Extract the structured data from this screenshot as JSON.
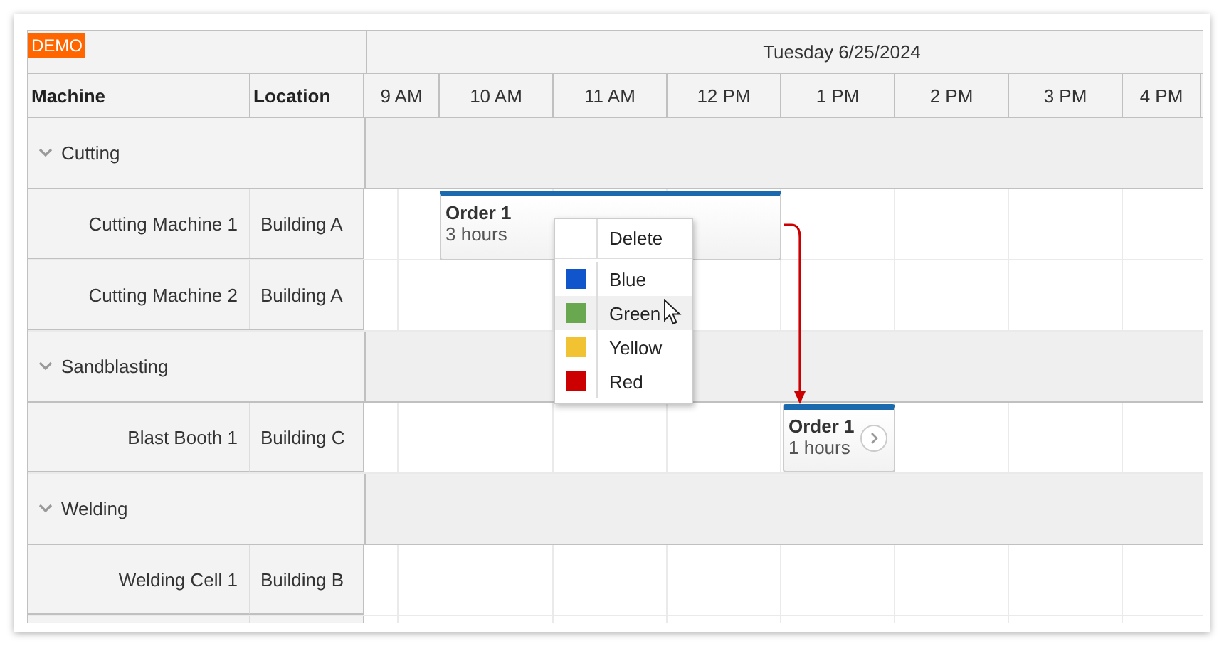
{
  "demo_badge": "DEMO",
  "date_header": "Tuesday 6/25/2024",
  "columns": [
    "Machine",
    "Location"
  ],
  "hours": [
    "9 AM",
    "10 AM",
    "11 AM",
    "12 PM",
    "1 PM",
    "2 PM",
    "3 PM",
    "4 PM"
  ],
  "rows": [
    {
      "kind": "group",
      "name": "Cutting",
      "expanded": true
    },
    {
      "kind": "resource",
      "name": "Cutting Machine 1",
      "location": "Building A",
      "events": [
        {
          "title": "Order 1",
          "duration": "3 hours"
        }
      ]
    },
    {
      "kind": "resource",
      "name": "Cutting Machine 2",
      "location": "Building A"
    },
    {
      "kind": "group",
      "name": "Sandblasting",
      "expanded": true
    },
    {
      "kind": "resource",
      "name": "Blast Booth 1",
      "location": "Building C",
      "events": [
        {
          "title": "Order 1",
          "duration": "1 hours"
        }
      ]
    },
    {
      "kind": "group",
      "name": "Welding",
      "expanded": true
    },
    {
      "kind": "resource",
      "name": "Welding Cell 1",
      "location": "Building B"
    }
  ],
  "context_menu": [
    {
      "kind": "action",
      "label": "Delete"
    },
    {
      "kind": "color",
      "label": "Blue",
      "color": "#1155cc",
      "highlighted": false
    },
    {
      "kind": "color",
      "label": "Green",
      "color": "#6aa84f",
      "highlighted": true
    },
    {
      "kind": "color",
      "label": "Yellow",
      "color": "#f1c232",
      "highlighted": false
    },
    {
      "kind": "color",
      "label": "Red",
      "color": "#cc0000",
      "highlighted": false
    }
  ]
}
